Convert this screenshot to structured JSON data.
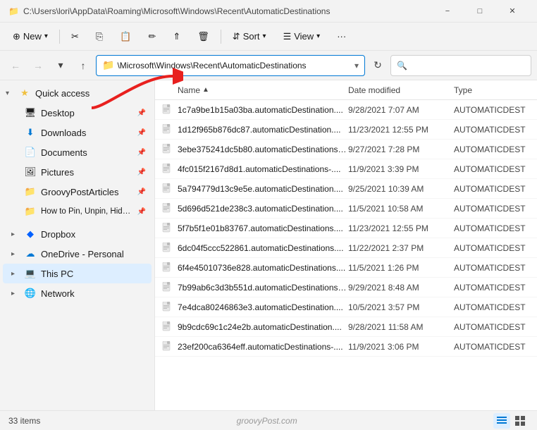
{
  "titleBar": {
    "path": "C:\\Users\\lori\\AppData\\Roaming\\Microsoft\\Windows\\Recent\\AutomaticDestinations",
    "controls": [
      "minimize",
      "maximize",
      "close"
    ]
  },
  "toolbar": {
    "new_label": "New",
    "cut_label": "",
    "copy_label": "",
    "paste_label": "",
    "rename_label": "",
    "share_label": "",
    "delete_label": "",
    "sort_label": "Sort",
    "view_label": "View",
    "more_label": "···"
  },
  "addressBar": {
    "path": "\\Microsoft\\Windows\\Recent\\AutomaticDestinations",
    "searchPlaceholder": "🔍"
  },
  "sidebar": {
    "quickAccess": {
      "label": "Quick access",
      "items": [
        {
          "label": "Desktop",
          "icon": "desktop",
          "pinned": true
        },
        {
          "label": "Downloads",
          "icon": "download",
          "pinned": true
        },
        {
          "label": "Documents",
          "icon": "document",
          "pinned": true
        },
        {
          "label": "Pictures",
          "icon": "picture",
          "pinned": true
        },
        {
          "label": "GroovyPostArticles",
          "icon": "folder-yellow",
          "pinned": true
        },
        {
          "label": "How to Pin, Unpin, Hide, and Re",
          "icon": "folder-yellow",
          "pinned": true
        }
      ]
    },
    "sections": [
      {
        "label": "Dropbox",
        "icon": "dropbox",
        "expanded": false
      },
      {
        "label": "OneDrive - Personal",
        "icon": "onedrive",
        "expanded": false
      },
      {
        "label": "This PC",
        "icon": "computer",
        "expanded": false,
        "active": true
      },
      {
        "label": "Network",
        "icon": "network",
        "expanded": false
      }
    ]
  },
  "fileList": {
    "columns": [
      {
        "label": "Name",
        "sort": "asc"
      },
      {
        "label": "Date modified"
      },
      {
        "label": "Type"
      }
    ],
    "files": [
      {
        "name": "1c7a9be1b15a03ba.automaticDestination....",
        "date": "9/28/2021 7:07 AM",
        "type": "AUTOMATICDEST"
      },
      {
        "name": "1d12f965b876dc87.automaticDestination....",
        "date": "11/23/2021 12:55 PM",
        "type": "AUTOMATICDEST"
      },
      {
        "name": "3ebe375241dc5b80.automaticDestinations-....",
        "date": "9/27/2021 7:28 PM",
        "type": "AUTOMATICDEST"
      },
      {
        "name": "4fc015f2167d8d1.automaticDestinations-....",
        "date": "11/9/2021 3:39 PM",
        "type": "AUTOMATICDEST"
      },
      {
        "name": "5a794779d13c9e5e.automaticDestination....",
        "date": "9/25/2021 10:39 AM",
        "type": "AUTOMATICDEST"
      },
      {
        "name": "5d696d521de238c3.automaticDestination....",
        "date": "11/5/2021 10:58 AM",
        "type": "AUTOMATICDEST"
      },
      {
        "name": "5f7b5f1e01b83767.automaticDestinations....",
        "date": "11/23/2021 12:55 PM",
        "type": "AUTOMATICDEST"
      },
      {
        "name": "6dc04f5ccc522861.automaticDestinations....",
        "date": "11/22/2021 2:37 PM",
        "type": "AUTOMATICDEST"
      },
      {
        "name": "6f4e45010736e828.automaticDestinations....",
        "date": "11/5/2021 1:26 PM",
        "type": "AUTOMATICDEST"
      },
      {
        "name": "7b99ab6c3d3b551d.automaticDestinations-....",
        "date": "9/29/2021 8:48 AM",
        "type": "AUTOMATICDEST"
      },
      {
        "name": "7e4dca80246863e3.automaticDestination....",
        "date": "10/5/2021 3:57 PM",
        "type": "AUTOMATICDEST"
      },
      {
        "name": "9b9cdc69c1c24e2b.automaticDestination....",
        "date": "9/28/2021 11:58 AM",
        "type": "AUTOMATICDEST"
      },
      {
        "name": "23ef200ca6364eff.automaticDestinations-....",
        "date": "11/9/2021 3:06 PM",
        "type": "AUTOMATICDEST"
      }
    ]
  },
  "statusBar": {
    "itemCount": "33 items",
    "watermark": "groovyPost.com"
  }
}
